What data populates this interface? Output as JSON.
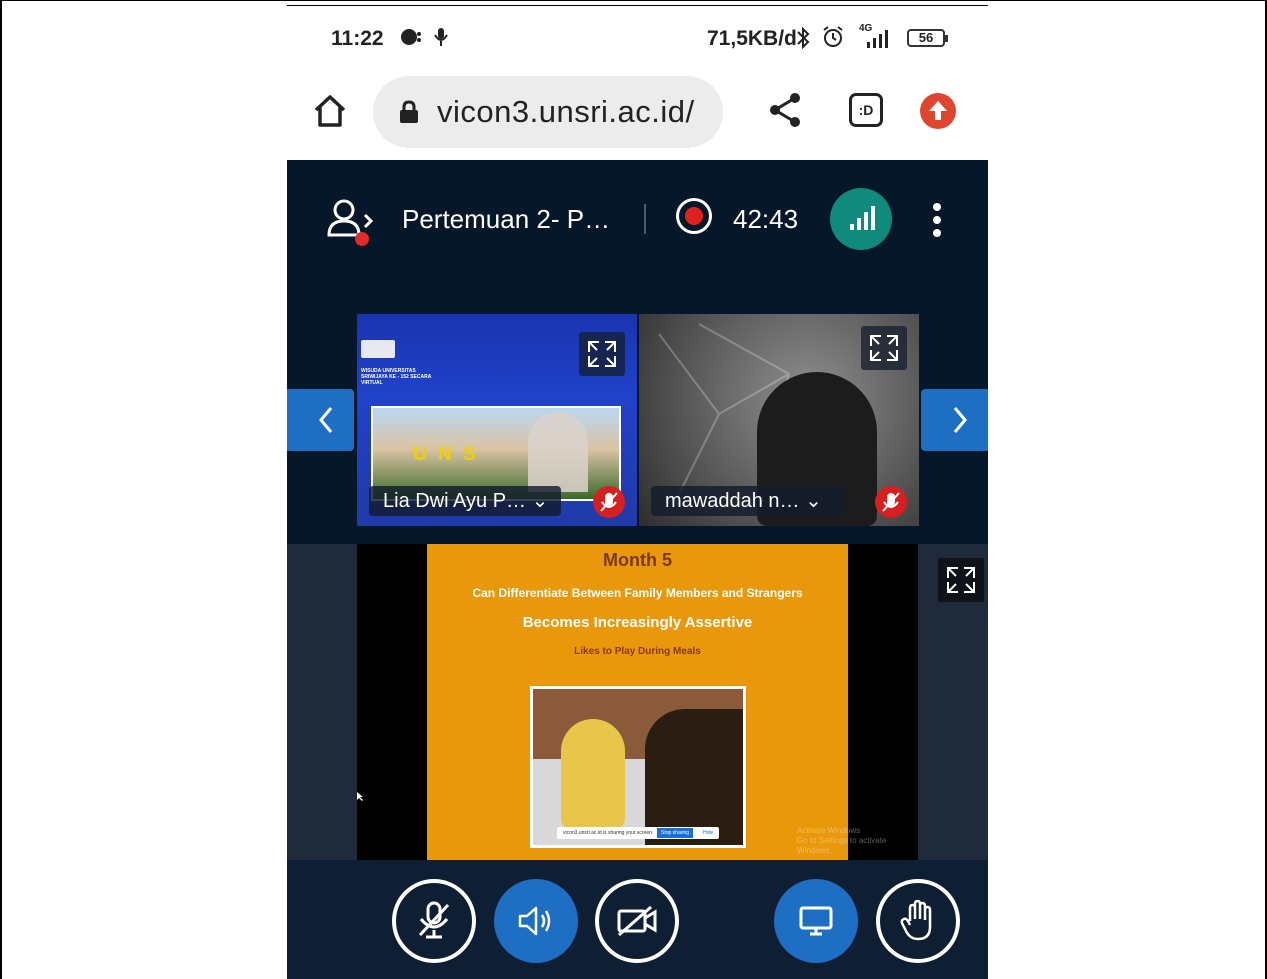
{
  "status_bar": {
    "time": "11:22",
    "speed": "71,5KB/d",
    "network": "4G",
    "battery": "56"
  },
  "browser": {
    "url": "vicon3.unsri.ac.id/",
    "d_badge": ":D"
  },
  "meeting": {
    "title": "Pertemuan 2- P…",
    "recording_time": "42:43"
  },
  "participants": [
    {
      "name": "Lia Dwi Ayu P… ⌄"
    },
    {
      "name": "mawaddah n… ⌄"
    }
  ],
  "tile1_slide": {
    "heading": "WISUDA UNIVERSITAS SRIWIJAYA KE - 152 SECARA VIRTUAL",
    "sign": "U N S"
  },
  "presentation": {
    "title": "Month 5",
    "line1": "Can Differentiate Between Family Members and Strangers",
    "line2": "Becomes Increasingly Assertive",
    "line3": "Likes to Play During Meals",
    "share_text": "vicon3.unsri.ac.id is sharing your screen.",
    "stop_sharing": "Stop sharing",
    "hide": "Hide",
    "watermark_1": "Activate Windows",
    "watermark_2": "Go to Settings to activate Windows."
  },
  "colors": {
    "meeting_bg": "#06172a",
    "accent_blue": "#1e6fc4",
    "connection_teal": "#0f8a7c",
    "record_red": "#e0221c",
    "slide_orange": "#e8980a"
  }
}
